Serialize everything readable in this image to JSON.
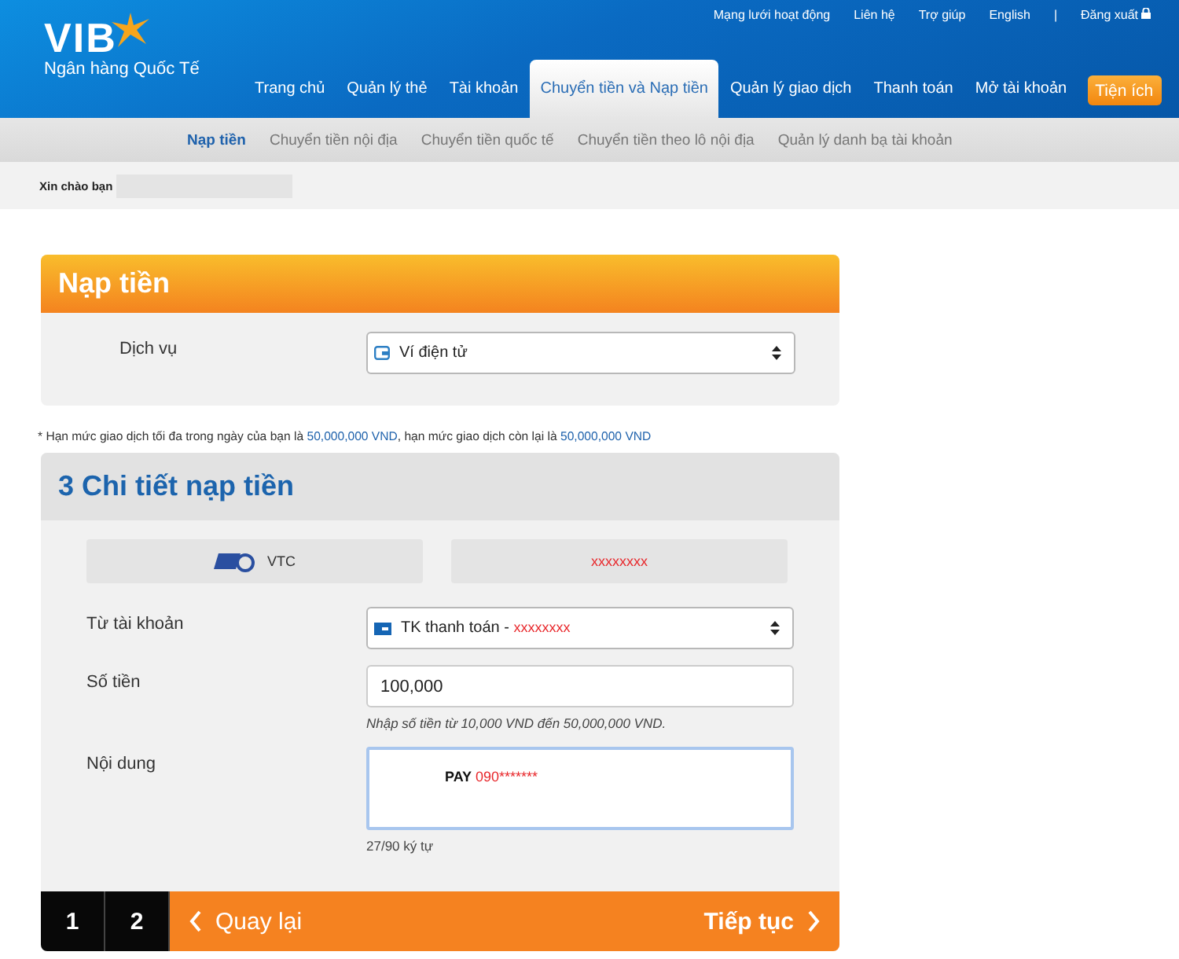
{
  "header": {
    "logo": "VIB",
    "tagline": "Ngân hàng Quốc Tế",
    "top_links": [
      {
        "kind": "link",
        "label": "Mạng lưới hoạt động"
      },
      {
        "kind": "link",
        "label": "Liên hệ"
      },
      {
        "kind": "link",
        "label": "Trợ giúp"
      },
      {
        "kind": "link",
        "label": "English"
      },
      {
        "kind": "separator",
        "label": "|"
      },
      {
        "kind": "logout",
        "label": "Đăng xuất"
      }
    ],
    "nav": [
      {
        "label": "Trang chủ",
        "selected": false
      },
      {
        "label": "Quản lý thẻ",
        "selected": false
      },
      {
        "label": "Tài khoản",
        "selected": false
      },
      {
        "label": "Chuyển tiền và Nạp tiền",
        "selected": true
      },
      {
        "label": "Quản lý giao dịch",
        "selected": false
      },
      {
        "label": "Thanh toán",
        "selected": false
      },
      {
        "label": "Mở tài khoản",
        "selected": false
      }
    ],
    "utility_button": "Tiện ích"
  },
  "subnav": [
    {
      "label": "Nạp tiền",
      "selected": true
    },
    {
      "label": "Chuyển tiền nội địa",
      "selected": false
    },
    {
      "label": "Chuyển tiền quốc tế",
      "selected": false
    },
    {
      "label": "Chuyển tiền theo lô nội địa",
      "selected": false
    },
    {
      "label": "Quản lý danh bạ tài khoản",
      "selected": false
    }
  ],
  "greeting": "Xin chào bạn",
  "service_panel": {
    "title": "Nạp tiền",
    "label": "Dịch vụ",
    "value": "Ví điện tử"
  },
  "limit_note": [
    {
      "text": "* Hạn mức giao dịch tối đa trong ngày của bạn là ",
      "highlight": false
    },
    {
      "text": "50,000,000 VND",
      "highlight": true
    },
    {
      "text": ", hạn mức giao dịch còn lại là ",
      "highlight": false
    },
    {
      "text": "50,000,000 VND",
      "highlight": true
    }
  ],
  "details_panel": {
    "title": "3 Chi tiết nạp tiền",
    "provider": "VTC",
    "wallet_id": "xxxxxxxx",
    "fields": [
      {
        "kind": "select",
        "label": "Từ tài khoản",
        "value": "TK thanh toán - ",
        "masked": "xxxxxxxx"
      },
      {
        "kind": "input",
        "label": "Số tiền",
        "value": "100,000",
        "hint": "Nhập số tiền từ 10,000 VND đến 50,000,000 VND."
      },
      {
        "kind": "textarea",
        "label": "Nội dung",
        "value": "PAY",
        "masked": "090*******",
        "hint": "27/90 ký tự"
      }
    ]
  },
  "footer": {
    "steps": [
      "1",
      "2"
    ],
    "back": "Quay lại",
    "next": "Tiếp tục"
  }
}
